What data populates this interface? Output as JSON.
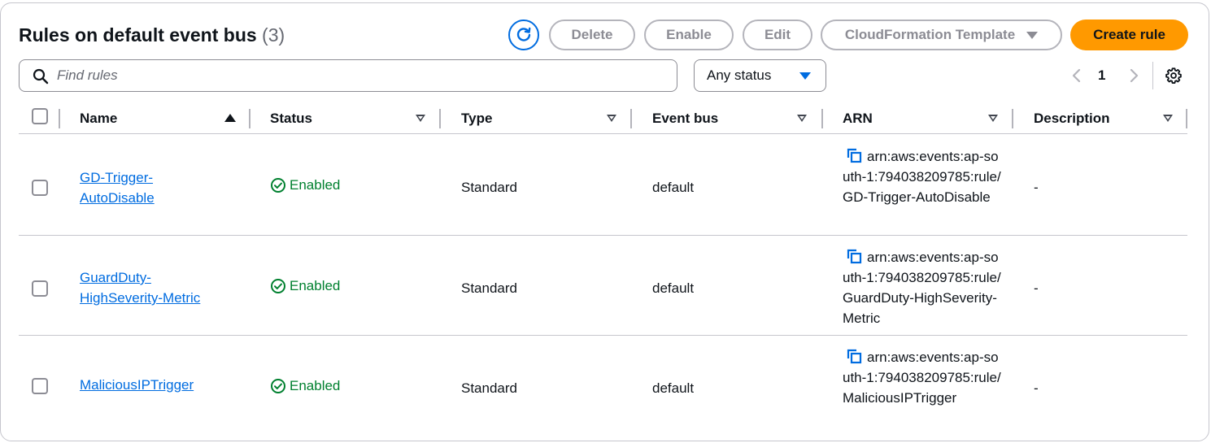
{
  "header": {
    "title": "Rules on default event bus",
    "count": "(3)"
  },
  "actions": {
    "delete_label": "Delete",
    "enable_label": "Enable",
    "edit_label": "Edit",
    "cloudformation_label": "CloudFormation Template",
    "create_label": "Create rule"
  },
  "search": {
    "placeholder": "Find rules",
    "value": ""
  },
  "filter": {
    "status_selected": "Any status"
  },
  "pagination": {
    "current_page": "1"
  },
  "table": {
    "columns": [
      "Name",
      "Status",
      "Type",
      "Event bus",
      "ARN",
      "Description"
    ],
    "rows": [
      {
        "name": "GD-Trigger-AutoDisable",
        "status": "Enabled",
        "type": "Standard",
        "event_bus": "default",
        "arn": "arn:aws:events:ap-south-1:794038209785:rule/GD-Trigger-AutoDisable",
        "description": "-"
      },
      {
        "name": "GuardDuty-HighSeverity-Metric",
        "status": "Enabled",
        "type": "Standard",
        "event_bus": "default",
        "arn": "arn:aws:events:ap-south-1:794038209785:rule/GuardDuty-HighSeverity-Metric",
        "description": "-"
      },
      {
        "name": "MaliciousIPTrigger",
        "status": "Enabled",
        "type": "Standard",
        "event_bus": "default",
        "arn": "arn:aws:events:ap-south-1:794038209785:rule/MaliciousIPTrigger",
        "description": "-"
      }
    ]
  },
  "colors": {
    "primary_button": "#ff9900",
    "link": "#006ce0",
    "status_enabled": "#00802f"
  },
  "icons": [
    "refresh-icon",
    "search-icon",
    "caret-down-icon",
    "chevron-left-icon",
    "chevron-right-icon",
    "gear-icon",
    "sort-ascending-icon",
    "sort-descending-icon",
    "status-check-icon",
    "copy-icon"
  ]
}
